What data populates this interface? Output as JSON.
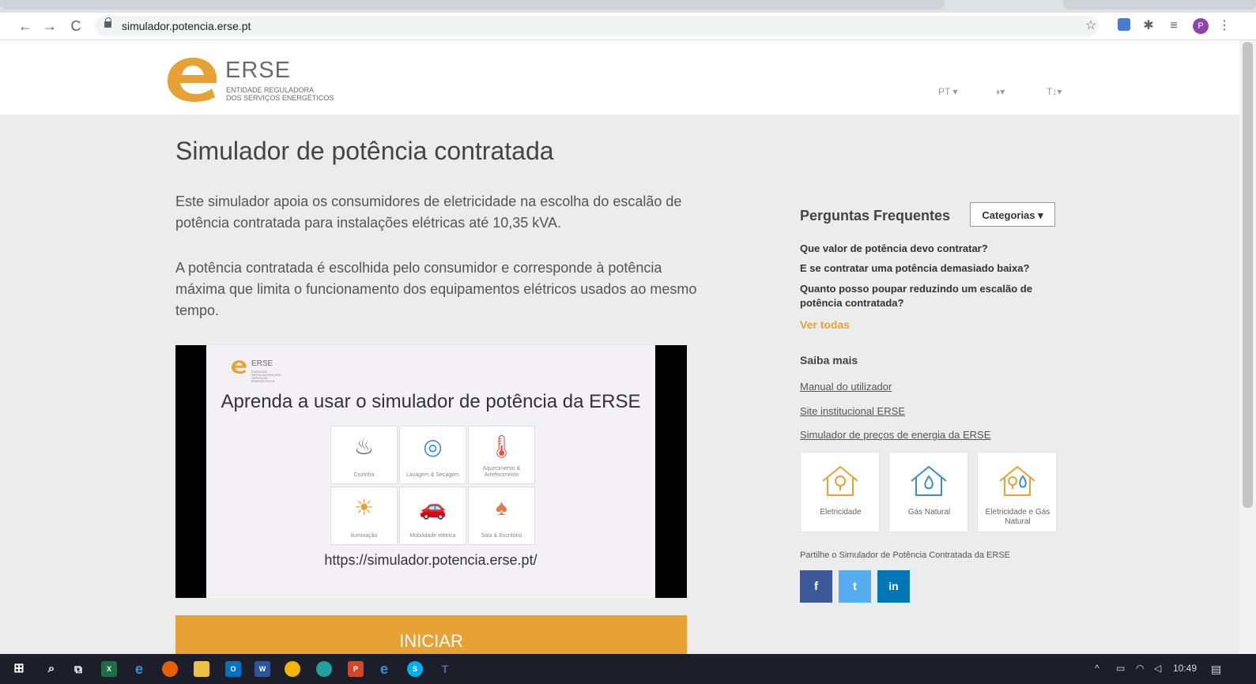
{
  "browser": {
    "url": "simulador.potencia.erse.pt",
    "nav": {
      "back": "←",
      "forward": "→",
      "reload": "C"
    }
  },
  "header": {
    "logo_title": "ERSE",
    "logo_sub_1": "ENTIDADE REGULADORA",
    "logo_sub_2": "DOS SERVIÇOS ENERGÉTICOS",
    "lang": "PT ▾",
    "contrast": "◑▾",
    "text_size": "T↕▾"
  },
  "main": {
    "title": "Simulador de potência contratada",
    "intro_1": "Este simulador apoia os consumidores de eletricidade na escolha do escalão de potência contratada para instalações elétricas até 10,35 kVA.",
    "intro_2": "A potência contratada é escolhida pelo consumidor e corresponde à potência máxima que limita o funcionamento dos equipamentos elétricos usados ao mesmo tempo.",
    "video": {
      "logo": "ERSE",
      "logo_sub": "ENTIDADE REGULADORA DOS SERVIÇOS ENERGÉTICOS",
      "title": "Aprenda a usar o simulador de potência da ERSE",
      "tiles": [
        {
          "label": "Cozinha",
          "icon": "chef-hat-icon"
        },
        {
          "label": "Lavagem & Secagem",
          "icon": "washing-machine-icon"
        },
        {
          "label": "Aquecimento & Arrefecimento",
          "icon": "thermometer-icon"
        },
        {
          "label": "Iluminação",
          "icon": "lamp-icon"
        },
        {
          "label": "Mobilidade elétrica",
          "icon": "electric-car-icon"
        },
        {
          "label": "Sala & Escritório",
          "icon": "armchair-icon"
        }
      ],
      "url": "https://simulador.potencia.erse.pt/"
    },
    "start_label": "INICIAR"
  },
  "sidebar": {
    "faq_title": "Perguntas Frequentes",
    "categories_label": "Categorias ▾",
    "questions": [
      "Que valor de potência devo contratar?",
      "E se contratar uma potência demasiado baixa?",
      "Quanto posso poupar reduzindo um escalão de potência contratada?"
    ],
    "see_all": "Ver todas",
    "more_title": "Saiba mais",
    "links": [
      "Manual do utilizador",
      "Site institucional ERSE",
      "Simulador de preços de energia da ERSE"
    ],
    "energy": [
      "Eletricidade",
      "Gás Natural",
      "Eletricidade e Gás Natural"
    ],
    "share_text": "Partilhe o Simulador de Potência Contratada da ERSE",
    "social": {
      "facebook": "f",
      "twitter": "t",
      "linkedin": "in"
    }
  },
  "taskbar": {
    "time": "10:49"
  },
  "colors": {
    "accent": "#e8a135",
    "facebook": "#3b5998",
    "twitter": "#55acee",
    "linkedin": "#0077b5"
  }
}
